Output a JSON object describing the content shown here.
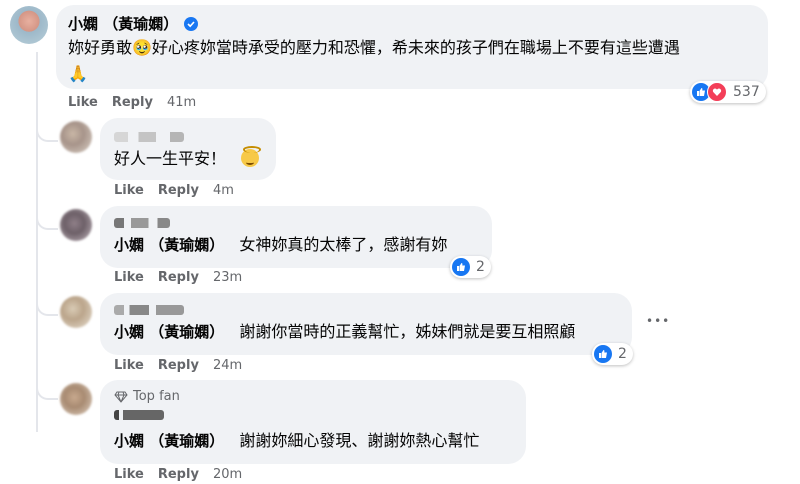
{
  "comments": [
    {
      "author": "小嫻 （黃瑜嫻）",
      "verified": true,
      "text": "妳好勇敢🥹好心疼妳當時承受的壓力和恐懼，希未來的孩子們在職場上不要有這些遭遇",
      "text_line2": "🙏",
      "like_label": "Like",
      "reply_label": "Reply",
      "time": "41m",
      "reaction_count": "537"
    },
    {
      "text": "好人一生平安！",
      "like_label": "Like",
      "reply_label": "Reply",
      "time": "4m"
    },
    {
      "mention": "小嫻 （黃瑜嫻）",
      "text": "女神妳真的太棒了，感謝有妳",
      "like_label": "Like",
      "reply_label": "Reply",
      "time": "23m",
      "reaction_count": "2"
    },
    {
      "mention": "小嫻 （黃瑜嫻）",
      "text": "謝謝你當時的正義幫忙，姊妹們就是要互相照顧",
      "like_label": "Like",
      "reply_label": "Reply",
      "time": "24m",
      "reaction_count": "2",
      "more_label": "•••"
    },
    {
      "badge": "Top fan",
      "mention": "小嫻 （黃瑜嫻）",
      "text": "謝謝妳細心發現、謝謝妳熱心幫忙",
      "like_label": "Like",
      "reply_label": "Reply",
      "time": "20m"
    }
  ],
  "colors": {
    "bubble": "#f0f2f5",
    "meta": "#65676b",
    "like": "#1877f2",
    "love": "#f33e58"
  }
}
